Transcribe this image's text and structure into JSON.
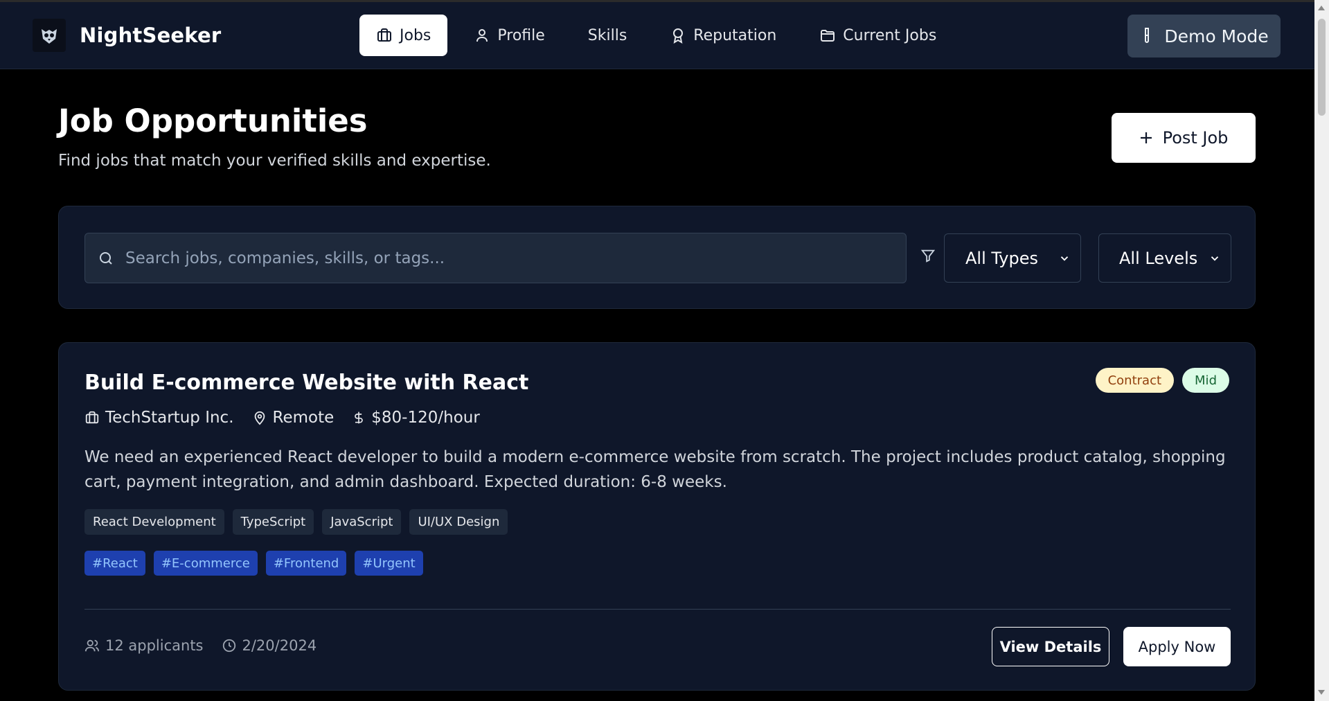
{
  "app": {
    "name": "NightSeeker"
  },
  "nav": {
    "items": [
      {
        "label": "Jobs",
        "icon": "briefcase-icon",
        "active": true
      },
      {
        "label": "Profile",
        "icon": "user-icon"
      },
      {
        "label": "Skills",
        "icon": ""
      },
      {
        "label": "Reputation",
        "icon": "award-icon"
      },
      {
        "label": "Current Jobs",
        "icon": "folder-icon"
      }
    ],
    "demo_label": "Demo Mode"
  },
  "header": {
    "title": "Job Opportunities",
    "subtitle": "Find jobs that match your verified skills and expertise.",
    "post_label": "Post Job"
  },
  "filters": {
    "search_placeholder": "Search jobs, companies, skills, or tags...",
    "type_selected": "All Types",
    "level_selected": "All Levels"
  },
  "job": {
    "title": "Build E-commerce Website with React",
    "badges": [
      "Contract",
      "Mid"
    ],
    "company": "TechStartup Inc.",
    "location": "Remote",
    "rate": "$80-120/hour",
    "description": "We need an experienced React developer to build a modern e-commerce website from scratch. The project includes product catalog, shopping cart, payment integration, and admin dashboard. Expected duration: 6-8 weeks.",
    "skills": [
      "React Development",
      "TypeScript",
      "JavaScript",
      "UI/UX Design"
    ],
    "tags": [
      "#React",
      "#E-commerce",
      "#Frontend",
      "#Urgent"
    ],
    "applicants": "12 applicants",
    "date": "2/20/2024",
    "view_label": "View Details",
    "apply_label": "Apply Now"
  },
  "colors": {
    "background": "#000000",
    "panel": "#0f172a",
    "tag_bg": "#1e40af",
    "tag_text": "#93c5fd"
  }
}
